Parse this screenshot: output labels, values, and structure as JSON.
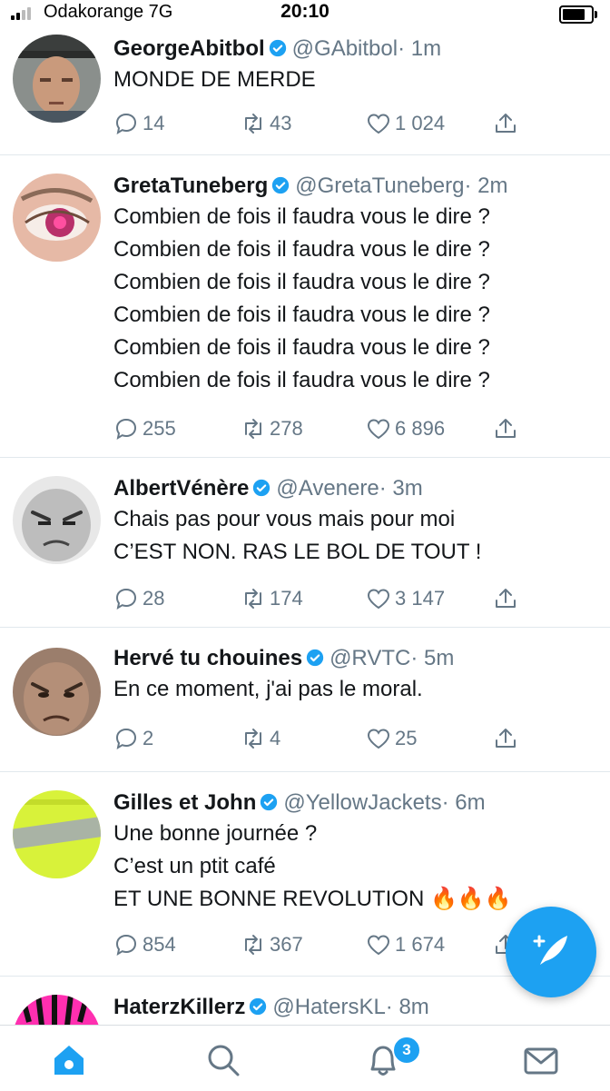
{
  "status_bar": {
    "carrier": "Odakorange  7G",
    "time": "20:10"
  },
  "tweets": [
    {
      "name": "GeorgeAbitbol",
      "handle": "@GAbitbol",
      "time": "· 1m",
      "lines": [
        "MONDE DE MERDE"
      ],
      "replies": "14",
      "retweets": "43",
      "likes": "1 024"
    },
    {
      "name": "GretaTuneberg",
      "handle": "@GretaTuneberg",
      "time": "· 2m",
      "lines": [
        "Combien de fois il faudra vous le dire ?",
        "Combien de fois il faudra vous le dire ?",
        "Combien de fois il faudra vous le dire ?",
        "Combien de fois il faudra vous le dire ?",
        "Combien de fois il faudra vous le dire ?",
        "Combien de fois il faudra vous le dire ?"
      ],
      "replies": "255",
      "retweets": "278",
      "likes": "6 896"
    },
    {
      "name": "AlbertVénère",
      "handle": "@Avenere",
      "time": "· 3m",
      "lines": [
        "Chais pas pour vous mais pour moi",
        "C’EST NON. RAS LE BOL DE TOUT !"
      ],
      "replies": "28",
      "retweets": "174",
      "likes": "3 147"
    },
    {
      "name": "Hervé tu chouines",
      "handle": "@RVTC",
      "time": "· 5m",
      "lines": [
        "En ce moment, j'ai pas le moral."
      ],
      "replies": "2",
      "retweets": "4",
      "likes": "25"
    },
    {
      "name": "Gilles et John",
      "handle": "@YellowJackets",
      "time": "· 6m",
      "lines": [
        "Une bonne journée ?",
        "C’est un ptit café",
        "ET UNE BONNE REVOLUTION 🔥🔥🔥"
      ],
      "replies": "854",
      "retweets": "367",
      "likes": "1 674"
    },
    {
      "name": "HaterzKillerz",
      "handle": "@HatersKL",
      "time": "· 8m",
      "lines": []
    }
  ],
  "tab_bar": {
    "notifications_badge": "3"
  },
  "colors": {
    "accent": "#1da1f2",
    "secondary_text": "#657786",
    "fire": "#ff7b00"
  }
}
